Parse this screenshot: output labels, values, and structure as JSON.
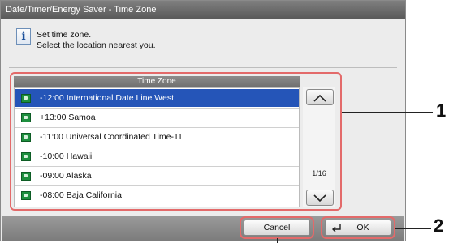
{
  "window": {
    "title": "Date/Timer/Energy Saver - Time Zone"
  },
  "message": {
    "line1": "Set time zone.",
    "line2": "Select the location nearest you.",
    "icon": "info-icon"
  },
  "list": {
    "header": "Time Zone",
    "items": [
      {
        "label": "-12:00 International Date Line West",
        "selected": true
      },
      {
        "label": "+13:00 Samoa",
        "selected": false
      },
      {
        "label": "-11:00 Universal Coordinated Time-11",
        "selected": false
      },
      {
        "label": "-10:00 Hawaii",
        "selected": false
      },
      {
        "label": "-09:00 Alaska",
        "selected": false
      },
      {
        "label": "-08:00 Baja California",
        "selected": false
      }
    ],
    "page_indicator": "1/16"
  },
  "buttons": {
    "cancel": "Cancel",
    "ok": "OK"
  },
  "callouts": {
    "one": "1",
    "two": "2"
  },
  "colors": {
    "selection": "#2555b8",
    "highlight_ring": "#e36a6a",
    "title_bar": "#5a5a5a"
  }
}
